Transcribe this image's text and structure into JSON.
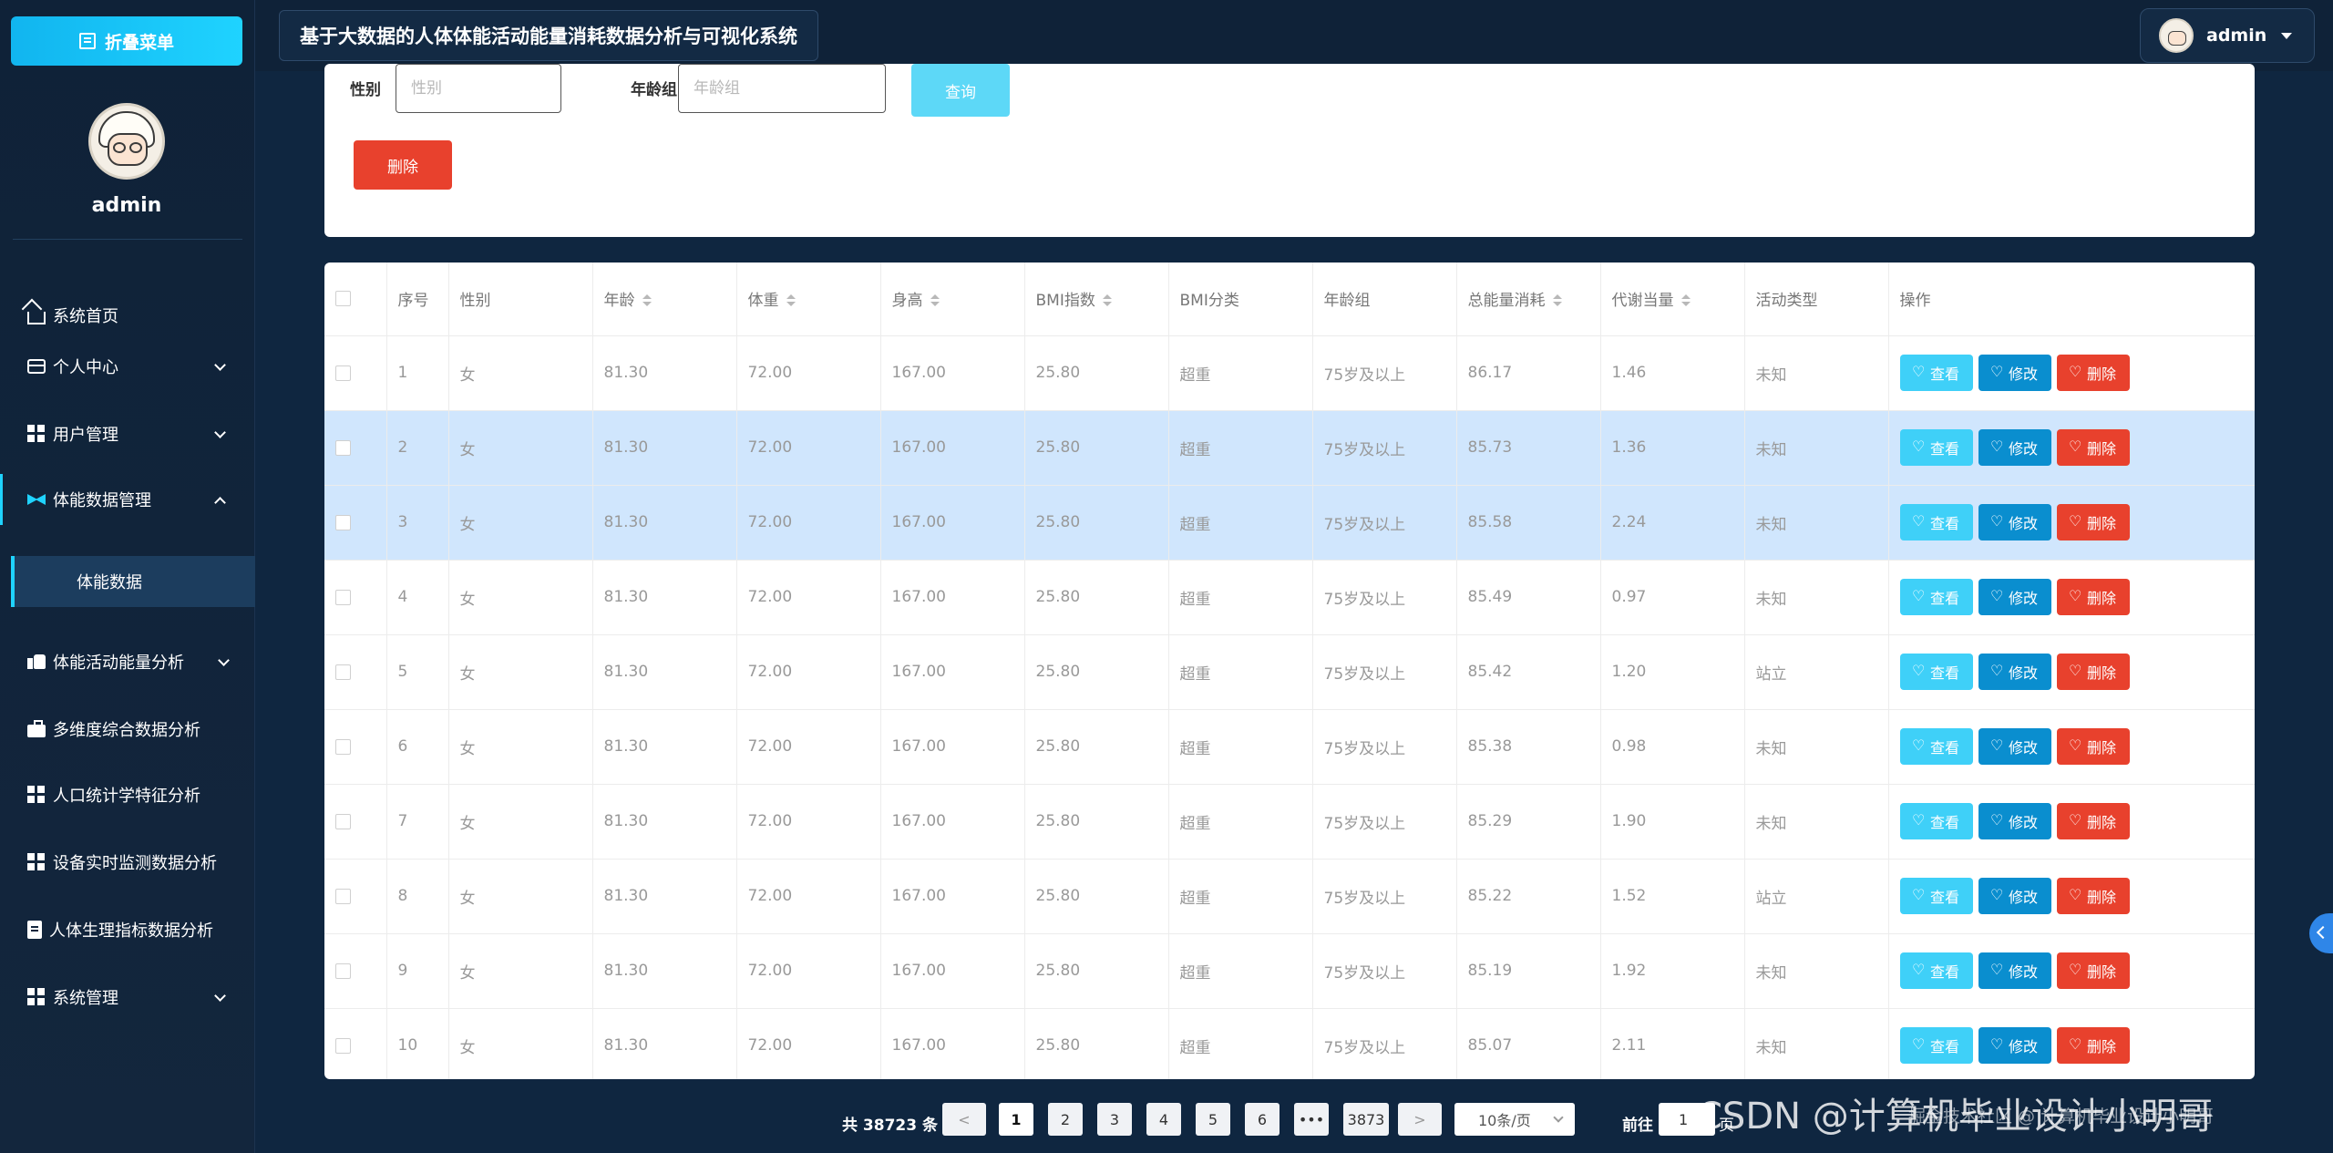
{
  "sidebar": {
    "collapse_label": "折叠菜单",
    "username": "admin",
    "menu": [
      {
        "label": "系统首页",
        "icon": "home-icon"
      },
      {
        "label": "个人中心",
        "icon": "card-icon"
      },
      {
        "label": "用户管理",
        "icon": "grid-icon"
      },
      {
        "label": "体能数据管理",
        "icon": "bolt-icon"
      },
      {
        "label": "体能活动能量分析",
        "icon": "thumb-icon"
      },
      {
        "label": "多维度综合数据分析",
        "icon": "bag-icon"
      },
      {
        "label": "人口统计学特征分析",
        "icon": "grid-icon"
      },
      {
        "label": "设备实时监测数据分析",
        "icon": "grid-icon"
      },
      {
        "label": "人体生理指标数据分析",
        "icon": "clipboard-icon"
      },
      {
        "label": "系统管理",
        "icon": "grid-icon"
      }
    ],
    "submenu_active": "体能数据"
  },
  "header": {
    "title": "基于大数据的人体体能活动能量消耗数据分析与可视化系统",
    "user": "admin"
  },
  "search": {
    "gender_label": "性别",
    "gender_placeholder": "性别",
    "age_group_label": "年龄组",
    "age_group_placeholder": "年龄组",
    "query_label": "查询",
    "delete_label": "删除"
  },
  "table": {
    "columns": [
      "序号",
      "性别",
      "年龄",
      "体重",
      "身高",
      "BMI指数",
      "BMI分类",
      "年龄组",
      "总能量消耗",
      "代谢当量",
      "活动类型",
      "操作"
    ],
    "actions": {
      "view": "查看",
      "edit": "修改",
      "delete": "删除"
    },
    "rows": [
      [
        "1",
        "女",
        "81.30",
        "72.00",
        "167.00",
        "25.80",
        "超重",
        "75岁及以上",
        "86.17",
        "1.46",
        "未知"
      ],
      [
        "2",
        "女",
        "81.30",
        "72.00",
        "167.00",
        "25.80",
        "超重",
        "75岁及以上",
        "85.73",
        "1.36",
        "未知"
      ],
      [
        "3",
        "女",
        "81.30",
        "72.00",
        "167.00",
        "25.80",
        "超重",
        "75岁及以上",
        "85.58",
        "2.24",
        "未知"
      ],
      [
        "4",
        "女",
        "81.30",
        "72.00",
        "167.00",
        "25.80",
        "超重",
        "75岁及以上",
        "85.49",
        "0.97",
        "未知"
      ],
      [
        "5",
        "女",
        "81.30",
        "72.00",
        "167.00",
        "25.80",
        "超重",
        "75岁及以上",
        "85.42",
        "1.20",
        "站立"
      ],
      [
        "6",
        "女",
        "81.30",
        "72.00",
        "167.00",
        "25.80",
        "超重",
        "75岁及以上",
        "85.38",
        "0.98",
        "未知"
      ],
      [
        "7",
        "女",
        "81.30",
        "72.00",
        "167.00",
        "25.80",
        "超重",
        "75岁及以上",
        "85.29",
        "1.90",
        "未知"
      ],
      [
        "8",
        "女",
        "81.30",
        "72.00",
        "167.00",
        "25.80",
        "超重",
        "75岁及以上",
        "85.22",
        "1.52",
        "站立"
      ],
      [
        "9",
        "女",
        "81.30",
        "72.00",
        "167.00",
        "25.80",
        "超重",
        "75岁及以上",
        "85.19",
        "1.92",
        "未知"
      ],
      [
        "10",
        "女",
        "81.30",
        "72.00",
        "167.00",
        "25.80",
        "超重",
        "75岁及以上",
        "85.07",
        "2.11",
        "未知"
      ]
    ]
  },
  "pagination": {
    "total_text": "共 38723 条",
    "prev": "<",
    "pages": [
      "1",
      "2",
      "3",
      "4",
      "5",
      "6",
      "•••",
      "3873"
    ],
    "current": "1",
    "next": ">",
    "page_size": "10条/页",
    "goto_label": "前往",
    "goto_value": "1",
    "goto_suffix": "页"
  },
  "watermark": {
    "text": "CSDN @计算机毕业设计小明哥",
    "overlay": "掘金技术社区 @ 计算机毕业设计小明哥"
  },
  "colors": {
    "accent": "#1fd3ff",
    "sidebar_bg": "#0f2238",
    "view_btn": "#3fd0f8",
    "edit_btn": "#0a8ecf",
    "delete_btn": "#e8412d",
    "selected_row": "#d0e6fd"
  }
}
